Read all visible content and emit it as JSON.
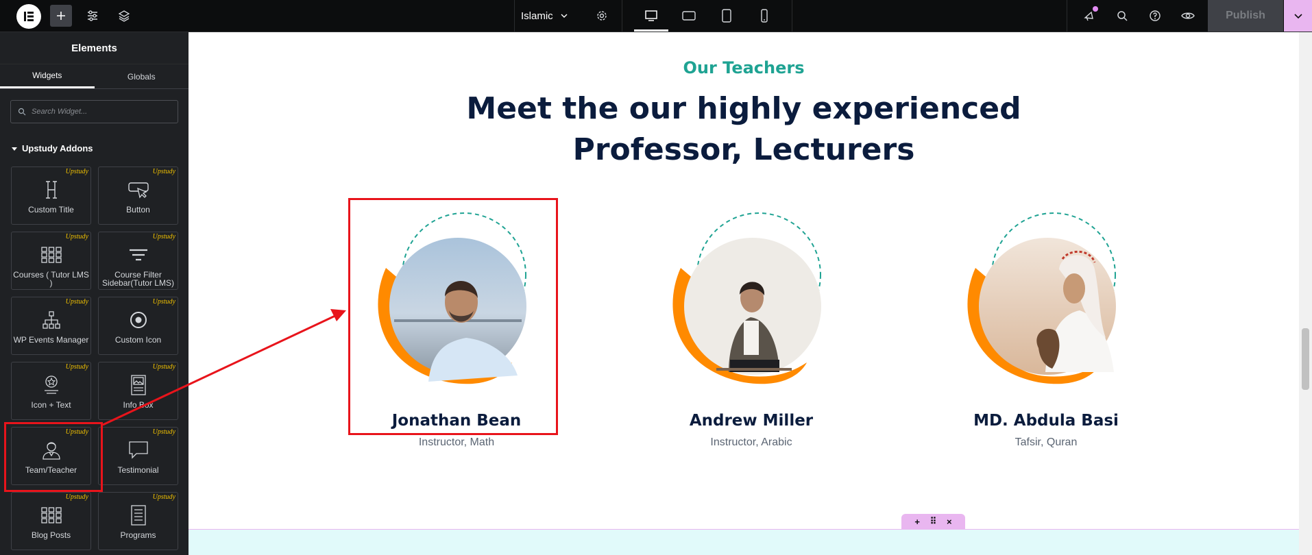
{
  "topbar": {
    "site_name": "Islamic",
    "publish_label": "Publish",
    "icons": [
      "elementor-logo-icon",
      "add-element-icon",
      "site-settings-icon",
      "structure-layers-icon",
      "page-settings-gear-icon",
      "desktop-icon",
      "tablet-landscape-icon",
      "tablet-icon",
      "mobile-icon",
      "notifications-icon",
      "search-icon",
      "help-icon",
      "preview-eye-icon",
      "chevron-down-icon"
    ]
  },
  "sidebar": {
    "title": "Elements",
    "tabs": [
      "Widgets",
      "Globals"
    ],
    "search_placeholder": "Search Widget...",
    "section_title": "Upstudy Addons",
    "badge": "Upstudy",
    "widgets": [
      {
        "label": "Custom Title",
        "icon": "heading-h-icon"
      },
      {
        "label": "Button",
        "icon": "button-pointer-icon"
      },
      {
        "label": "Courses ( Tutor LMS )",
        "icon": "grid-icon"
      },
      {
        "label": "Course Filter Sidebar(Tutor LMS)",
        "icon": "filter-icon"
      },
      {
        "label": "WP Events Manager",
        "icon": "sitemap-icon"
      },
      {
        "label": "Custom Icon",
        "icon": "target-icon"
      },
      {
        "label": "Icon + Text",
        "icon": "icon-box-icon"
      },
      {
        "label": "Info Box",
        "icon": "image-box-icon"
      },
      {
        "label": "Team/Teacher",
        "icon": "person-icon"
      },
      {
        "label": "Testimonial",
        "icon": "speech-bubble-icon"
      },
      {
        "label": "Blog Posts",
        "icon": "grid-icon"
      },
      {
        "label": "Programs",
        "icon": "list-document-icon"
      }
    ]
  },
  "canvas": {
    "subtitle": "Our Teachers",
    "headline_line1": "Meet the our highly experienced",
    "headline_line2": "Professor, Lecturers",
    "teachers": [
      {
        "name": "Jonathan Bean",
        "role": "Instructor, Math"
      },
      {
        "name": "Andrew Miller",
        "role": "Instructor, Arabic"
      },
      {
        "name": "MD. Abdula Basi",
        "role": "Tafsir, Quran"
      }
    ],
    "section_toolbar": {
      "add": "+",
      "move": "⠿",
      "close": "×"
    }
  },
  "colors": {
    "accent_teal": "#1fa393",
    "heading_navy": "#0b1c3d",
    "orange": "#ff8a00",
    "highlight_red": "#e8141b",
    "editor_pink": "#e9b6f0"
  }
}
